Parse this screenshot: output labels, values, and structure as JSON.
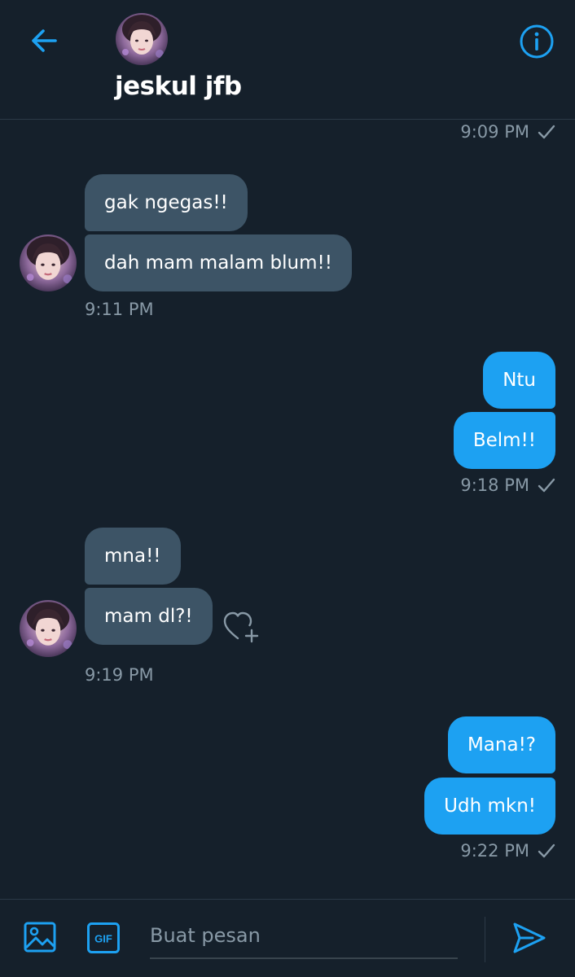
{
  "header": {
    "contact_name": "jeskul jfb",
    "back_icon": "arrow-left-icon",
    "info_icon": "info-icon"
  },
  "colors": {
    "background": "#15202b",
    "accent": "#1da1f2",
    "incoming_bubble": "#3d5466",
    "muted_text": "#8899a6"
  },
  "messages": {
    "ts_0": "9:09 PM",
    "g1_m1": "gak ngegas!!",
    "g1_m2": "dah mam malam blum!!",
    "ts_1": "9:11 PM",
    "g2_m1": "Ntu",
    "g2_m2": "Belm!!",
    "ts_2": "9:18 PM",
    "g3_m1": "mna!!",
    "g3_m2": "mam dl?!",
    "ts_3": "9:19 PM",
    "g4_m1": "Mana!?",
    "g4_m2": "Udh mkn!",
    "ts_4": "9:22 PM"
  },
  "composer": {
    "placeholder": "Buat pesan",
    "gif_label": "GIF",
    "media_icon": "image-icon",
    "send_icon": "send-icon"
  }
}
